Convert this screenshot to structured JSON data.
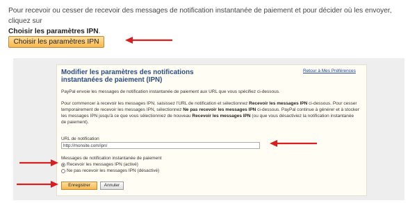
{
  "intro": {
    "text": "Pour recevoir ou cesser de recevoir des messages de notification instantanée de paiement et pour décider où les envoyer, cliquez sur",
    "link": "Choisir les paramètres IPN",
    "end": "."
  },
  "choose_button": "Choisir les paramètres IPN",
  "panel": {
    "title": "Modifier les paramètres des notifications instantanées de paiement (IPN)",
    "return_link": "Retour à Mes Préférences",
    "p1": "PayPal envoie les messages de notification instantanée de paiement aux URL que vous spécifiez ci-dessous.",
    "p2": {
      "a": "Pour commencer à recevoir les messages IPN, saisissez l'URL de notification et sélectionnez ",
      "b": "Recevoir les messages IPN",
      "c": " ci-dessous. Pour cesser temporairement de recevoir les messages IPN, sélectionnez ",
      "d": "Ne pas recevoir les messages IPN",
      "e": " ci-dessous. PayPal continue à générer et à stocker les messages IPN jusqu'à ce que vous sélectionniez de nouveau ",
      "f": "Recevoir les messages IPN",
      "g": " (ou que vous désactiviez la notification instantanée de paiement)."
    },
    "url_label": "URL de notification",
    "url_value": "http://monsite.com/ipn/",
    "messages_label": "Messages de notification instantanée de paiement",
    "radio_on": "Recevoir les messages IPN (activé)",
    "radio_off": "Ne pas recevoir les messages IPN (désactivé)",
    "selected": "radio_on",
    "save_button": "Enregistrer",
    "cancel_button": "Annuler"
  },
  "colors": {
    "arrow": "#d81e1e",
    "title": "#2c4d84",
    "button_orange": "#f7b84c",
    "link": "#1a3f9e"
  }
}
